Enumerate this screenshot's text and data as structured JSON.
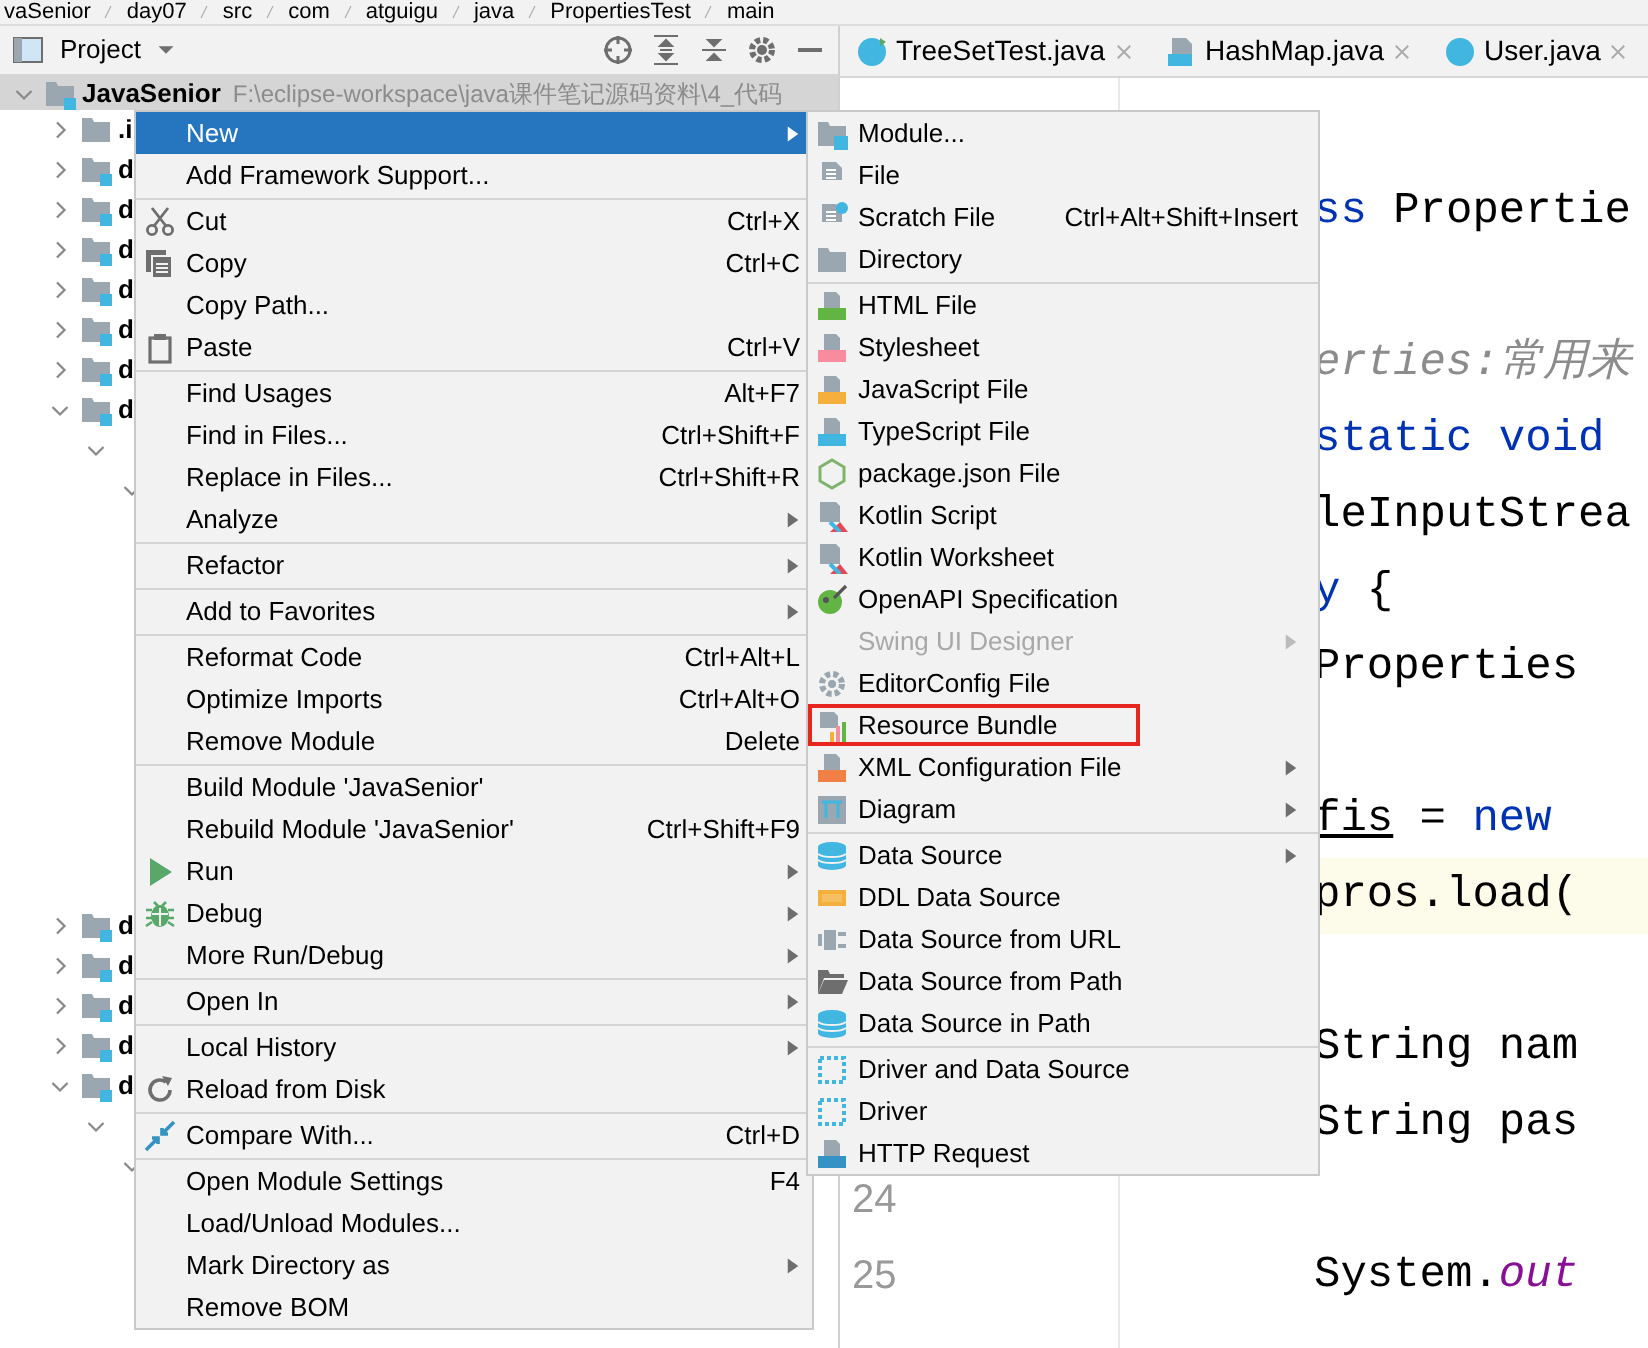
{
  "breadcrumb": [
    "vaSenior",
    "day07",
    "src",
    "com",
    "atguigu",
    "java",
    "PropertiesTest",
    "main"
  ],
  "project_panel": {
    "title": "Project"
  },
  "tree": [
    {
      "label": "JavaSenior",
      "path": "F:\\eclipse-workspace\\java课件笔记源码资料\\4_代码",
      "kind": "module",
      "expanded": true,
      "children": [
        {
          "label": ".i",
          "kind": "folder",
          "expanded": false
        },
        {
          "label": "d",
          "kind": "module",
          "expanded": false
        },
        {
          "label": "d",
          "kind": "module",
          "expanded": false
        },
        {
          "label": "d",
          "kind": "module",
          "expanded": false
        },
        {
          "label": "d",
          "kind": "module",
          "expanded": false
        },
        {
          "label": "d",
          "kind": "module",
          "expanded": false
        },
        {
          "label": "d",
          "kind": "module",
          "expanded": false
        },
        {
          "label": "d",
          "kind": "module",
          "expanded": true,
          "children": [
            {
              "expanded": true,
              "children": [
                {
                  "expanded": true
                }
              ]
            }
          ]
        }
      ]
    }
  ],
  "tree_lower": [
    {
      "label": "d",
      "kind": "module",
      "expanded": false
    },
    {
      "label": "d",
      "kind": "module",
      "expanded": false
    },
    {
      "label": "d",
      "kind": "module",
      "expanded": false
    },
    {
      "label": "d",
      "kind": "module",
      "expanded": false
    },
    {
      "label": "d",
      "kind": "module",
      "expanded": true,
      "children": [
        {
          "expanded": true,
          "children": [
            {
              "expanded": true
            }
          ]
        }
      ]
    }
  ],
  "tabs": [
    {
      "label": "TreeSetTest.java",
      "kind": "runnable-class"
    },
    {
      "label": "HashMap.java",
      "kind": "library-file"
    },
    {
      "label": "User.java",
      "kind": "class"
    }
  ],
  "code_lines": [
    {
      "kind": "code",
      "segments": [
        {
          "kind": "keyword",
          "text": "ss"
        },
        {
          "kind": "plain",
          "text": " Propertie"
        }
      ]
    },
    {
      "kind": "blank"
    },
    {
      "kind": "code",
      "segments": [
        {
          "kind": "comment",
          "text": "erties:常用来"
        }
      ]
    },
    {
      "kind": "code",
      "segments": [
        {
          "kind": "keyword",
          "text": "static void"
        }
      ]
    },
    {
      "kind": "code",
      "segments": [
        {
          "kind": "plain",
          "text": "leInputStrea"
        }
      ]
    },
    {
      "kind": "code",
      "segments": [
        {
          "kind": "keyword",
          "text": "y"
        },
        {
          "kind": "plain",
          "text": " {"
        }
      ]
    },
    {
      "kind": "code",
      "segments": [
        {
          "kind": "plain",
          "text": "Properties"
        }
      ]
    },
    {
      "kind": "blank"
    },
    {
      "kind": "code",
      "segments": [
        {
          "kind": "reassigned",
          "text": "fis"
        },
        {
          "kind": "plain",
          "text": " = "
        },
        {
          "kind": "keyword",
          "text": "new"
        }
      ]
    },
    {
      "kind": "code",
      "current": true,
      "segments": [
        {
          "kind": "plain",
          "text": "pros.load("
        }
      ]
    },
    {
      "kind": "blank"
    },
    {
      "kind": "code",
      "segments": [
        {
          "kind": "plain",
          "text": "String nam"
        }
      ]
    },
    {
      "kind": "code",
      "segments": [
        {
          "kind": "plain",
          "text": "String pas"
        }
      ]
    },
    {
      "kind": "blank",
      "number": "24"
    },
    {
      "kind": "code",
      "number": "25",
      "segments": [
        {
          "kind": "plain",
          "text": "System."
        },
        {
          "kind": "static-field",
          "text": "out"
        }
      ]
    }
  ],
  "context_menu": [
    {
      "kind": "plain",
      "label": "New",
      "selected": true,
      "arrow": true
    },
    {
      "kind": "plain",
      "label": "Add Framework Support...",
      "selected": false,
      "arrow": false
    },
    {
      "kind": "separator"
    },
    {
      "kind": "cut",
      "label": "Cut",
      "shortcut": "Ctrl+X",
      "selected": false,
      "arrow": false
    },
    {
      "kind": "copy",
      "label": "Copy",
      "shortcut": "Ctrl+C",
      "selected": false,
      "arrow": false
    },
    {
      "kind": "plain",
      "label": "Copy Path...",
      "selected": false,
      "arrow": false
    },
    {
      "kind": "paste",
      "label": "Paste",
      "shortcut": "Ctrl+V",
      "selected": false,
      "arrow": false
    },
    {
      "kind": "separator"
    },
    {
      "kind": "plain",
      "label": "Find Usages",
      "shortcut": "Alt+F7",
      "selected": false,
      "arrow": false
    },
    {
      "kind": "plain",
      "label": "Find in Files...",
      "shortcut": "Ctrl+Shift+F",
      "selected": false,
      "arrow": false
    },
    {
      "kind": "plain",
      "label": "Replace in Files...",
      "shortcut": "Ctrl+Shift+R",
      "selected": false,
      "arrow": false
    },
    {
      "kind": "plain",
      "label": "Analyze",
      "selected": false,
      "arrow": true
    },
    {
      "kind": "separator"
    },
    {
      "kind": "plain",
      "label": "Refactor",
      "selected": false,
      "arrow": true
    },
    {
      "kind": "separator"
    },
    {
      "kind": "plain",
      "label": "Add to Favorites",
      "selected": false,
      "arrow": true
    },
    {
      "kind": "separator"
    },
    {
      "kind": "plain",
      "label": "Reformat Code",
      "shortcut": "Ctrl+Alt+L",
      "selected": false,
      "arrow": false
    },
    {
      "kind": "plain",
      "label": "Optimize Imports",
      "shortcut": "Ctrl+Alt+O",
      "selected": false,
      "arrow": false
    },
    {
      "kind": "plain",
      "label": "Remove Module",
      "shortcut": "Delete",
      "selected": false,
      "arrow": false
    },
    {
      "kind": "separator"
    },
    {
      "kind": "plain",
      "label": "Build Module 'JavaSenior'",
      "selected": false,
      "arrow": false
    },
    {
      "kind": "plain",
      "label": "Rebuild Module 'JavaSenior'",
      "shortcut": "Ctrl+Shift+F9",
      "selected": false,
      "arrow": false
    },
    {
      "kind": "run",
      "label": "Run",
      "selected": false,
      "arrow": true
    },
    {
      "kind": "debug",
      "label": "Debug",
      "selected": false,
      "arrow": true
    },
    {
      "kind": "plain",
      "label": "More Run/Debug",
      "selected": false,
      "arrow": true
    },
    {
      "kind": "separator"
    },
    {
      "kind": "plain",
      "label": "Open In",
      "selected": false,
      "arrow": true
    },
    {
      "kind": "separator"
    },
    {
      "kind": "plain",
      "label": "Local History",
      "selected": false,
      "arrow": true
    },
    {
      "kind": "reload",
      "label": "Reload from Disk",
      "selected": false,
      "arrow": false
    },
    {
      "kind": "separator"
    },
    {
      "kind": "compare",
      "label": "Compare With...",
      "shortcut": "Ctrl+D",
      "selected": false,
      "arrow": false
    },
    {
      "kind": "separator"
    },
    {
      "kind": "plain",
      "label": "Open Module Settings",
      "shortcut": "F4",
      "selected": false,
      "arrow": false
    },
    {
      "kind": "plain",
      "label": "Load/Unload Modules...",
      "selected": false,
      "arrow": false
    },
    {
      "kind": "plain",
      "label": "Mark Directory as",
      "selected": false,
      "arrow": true
    },
    {
      "kind": "plain",
      "label": "Remove BOM",
      "selected": false,
      "arrow": false
    }
  ],
  "new_submenu": [
    {
      "kind": "module",
      "label": "Module...",
      "disabled": false,
      "annotated": false,
      "arrow": false
    },
    {
      "kind": "file",
      "label": "File",
      "disabled": false,
      "annotated": false,
      "arrow": false
    },
    {
      "kind": "scratch",
      "label": "Scratch File",
      "shortcut": "Ctrl+Alt+Shift+Insert",
      "disabled": false,
      "annotated": false,
      "arrow": false
    },
    {
      "kind": "directory",
      "label": "Directory",
      "disabled": false,
      "annotated": false,
      "arrow": false
    },
    {
      "kind": "separator"
    },
    {
      "kind": "html",
      "label": "HTML File",
      "disabled": false,
      "annotated": false,
      "arrow": false
    },
    {
      "kind": "css",
      "label": "Stylesheet",
      "disabled": false,
      "annotated": false,
      "arrow": false
    },
    {
      "kind": "js",
      "label": "JavaScript File",
      "disabled": false,
      "annotated": false,
      "arrow": false
    },
    {
      "kind": "ts",
      "label": "TypeScript File",
      "disabled": false,
      "annotated": false,
      "arrow": false
    },
    {
      "kind": "npm",
      "label": "package.json File",
      "disabled": false,
      "annotated": false,
      "arrow": false
    },
    {
      "kind": "kotlin",
      "label": "Kotlin Script",
      "disabled": false,
      "annotated": false,
      "arrow": false
    },
    {
      "kind": "kotlin",
      "label": "Kotlin Worksheet",
      "disabled": false,
      "annotated": false,
      "arrow": false
    },
    {
      "kind": "openapi",
      "label": "OpenAPI Specification",
      "disabled": false,
      "annotated": false,
      "arrow": false
    },
    {
      "kind": "plain",
      "label": "Swing UI Designer",
      "disabled": true,
      "annotated": false,
      "arrow": true
    },
    {
      "kind": "editorconfig",
      "label": "EditorConfig File",
      "disabled": false,
      "annotated": false,
      "arrow": false
    },
    {
      "kind": "bundle",
      "label": "Resource Bundle",
      "disabled": false,
      "annotated": true,
      "arrow": false
    },
    {
      "kind": "xml",
      "label": "XML Configuration File",
      "disabled": false,
      "annotated": false,
      "arrow": true
    },
    {
      "kind": "diagram",
      "label": "Diagram",
      "disabled": false,
      "annotated": false,
      "arrow": true
    },
    {
      "kind": "separator"
    },
    {
      "kind": "database",
      "label": "Data Source",
      "disabled": false,
      "annotated": false,
      "arrow": true
    },
    {
      "kind": "ddl",
      "label": "DDL Data Source",
      "disabled": false,
      "annotated": false,
      "arrow": false
    },
    {
      "kind": "plug",
      "label": "Data Source from URL",
      "disabled": false,
      "annotated": false,
      "arrow": false
    },
    {
      "kind": "openfolder",
      "label": "Data Source from Path",
      "disabled": false,
      "annotated": false,
      "arrow": false
    },
    {
      "kind": "database",
      "label": "Data Source in Path",
      "disabled": false,
      "annotated": false,
      "arrow": false
    },
    {
      "kind": "separator"
    },
    {
      "kind": "driver",
      "label": "Driver and Data Source",
      "disabled": false,
      "annotated": false,
      "arrow": false
    },
    {
      "kind": "driver",
      "label": "Driver",
      "disabled": false,
      "annotated": false,
      "arrow": false
    },
    {
      "kind": "api",
      "label": "HTTP Request",
      "disabled": false,
      "annotated": false,
      "arrow": false
    }
  ]
}
